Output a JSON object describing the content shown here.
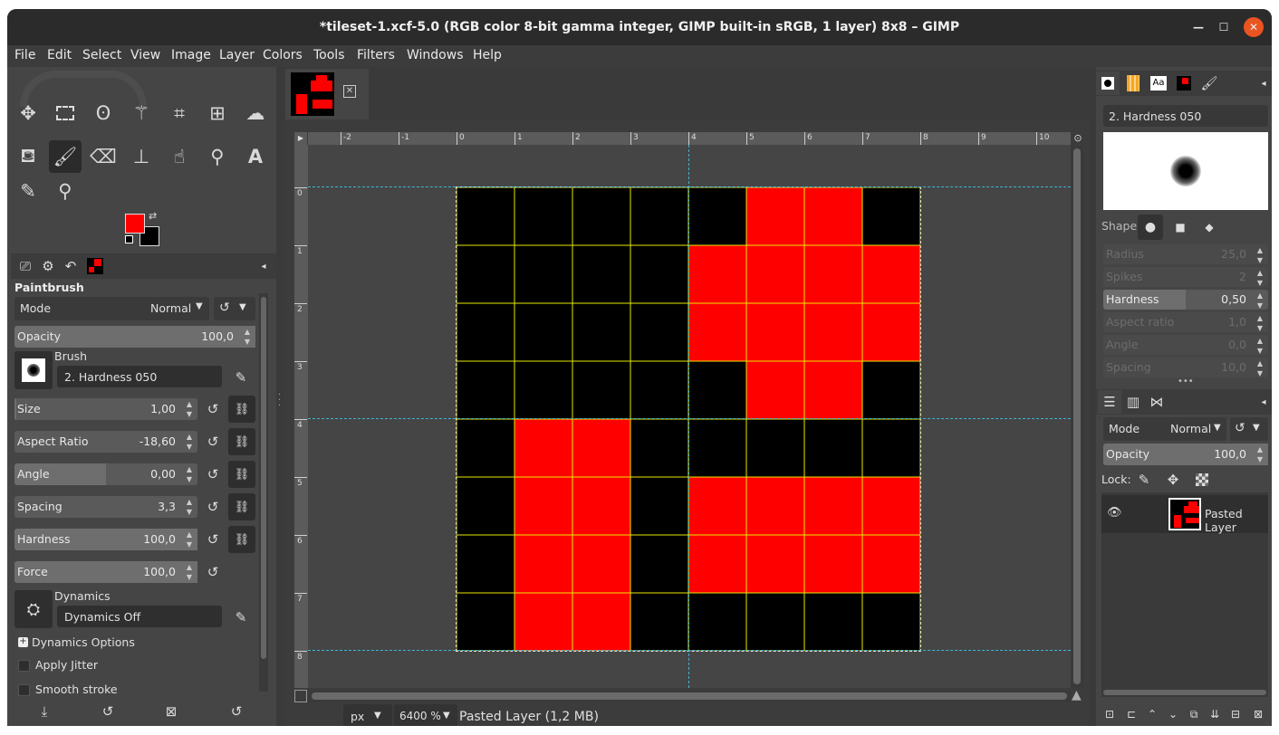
{
  "window": {
    "title": "*tileset-1.xcf-5.0 (RGB color 8-bit gamma integer, GIMP built-in sRGB, 1 layer) 8x8 – GIMP"
  },
  "menu": [
    "File",
    "Edit",
    "Select",
    "View",
    "Image",
    "Layer",
    "Colors",
    "Tools",
    "Filters",
    "Windows",
    "Help"
  ],
  "toolbox": {
    "tools": [
      "move-tool",
      "rect-select-tool",
      "free-select-tool",
      "fuzzy-select-tool",
      "crop-tool",
      "unified-transform-tool",
      "warp-transform-tool",
      "bucket-fill-tool",
      "paintbrush-tool",
      "eraser-tool",
      "clone-tool",
      "smudge-tool",
      "paths-tool",
      "text-tool",
      "color-picker-tool",
      "zoom-tool"
    ],
    "fg_color": "#ff0000",
    "bg_color": "#000000"
  },
  "tool_options": {
    "title": "Paintbrush",
    "mode_label": "Mode",
    "mode_value": "Normal",
    "opacity_label": "Opacity",
    "opacity_value": "100,0",
    "opacity_fraction": 1.0,
    "brush_label": "Brush",
    "brush_name": "2. Hardness 050",
    "sliders": [
      {
        "label": "Size",
        "value": "1,00",
        "fraction": 0.01,
        "chain": true
      },
      {
        "label": "Aspect Ratio",
        "value": "-18,60",
        "fraction": 0.0,
        "chain": true
      },
      {
        "label": "Angle",
        "value": "0,00",
        "fraction": 0.5,
        "chain": true
      },
      {
        "label": "Spacing",
        "value": "3,3",
        "fraction": 0.0,
        "chain": true
      },
      {
        "label": "Hardness",
        "value": "100,0",
        "fraction": 1.0,
        "chain": true
      },
      {
        "label": "Force",
        "value": "100,0",
        "fraction": 1.0,
        "chain": false
      }
    ],
    "dynamics_label": "Dynamics",
    "dynamics_value": "Dynamics Off",
    "dynamics_options": "Dynamics Options",
    "apply_jitter": "Apply Jitter",
    "smooth_stroke": "Smooth stroke"
  },
  "canvas": {
    "h_ruler": [
      "-2",
      "-1",
      "0",
      "1",
      "2",
      "3",
      "4",
      "5",
      "6",
      "7",
      "8",
      "9",
      "10"
    ],
    "v_ruler": [
      "0",
      "1",
      "2",
      "3",
      "4",
      "5",
      "6",
      "7",
      "8"
    ],
    "pixels": [
      "00000110",
      "00001111",
      "00001111",
      "00000110",
      "01100000",
      "01101111",
      "01101111",
      "01100000"
    ],
    "pixel_on": "#ff0000",
    "pixel_off": "#000000",
    "grid_color": "#e8e800"
  },
  "statusbar": {
    "unit": "px",
    "zoom": "6400 %",
    "info": "Pasted Layer (1,2 MB)"
  },
  "brushes_panel": {
    "brush_name": "2. Hardness 050",
    "shape_label": "Shape:",
    "params": [
      {
        "label": "Radius",
        "value": "25,0",
        "fraction": 0.0,
        "enabled": false
      },
      {
        "label": "Spikes",
        "value": "2",
        "fraction": 0.0,
        "enabled": false
      },
      {
        "label": "Hardness",
        "value": "0,50",
        "fraction": 0.5,
        "enabled": true
      },
      {
        "label": "Aspect ratio",
        "value": "1,0",
        "fraction": 0.0,
        "enabled": false
      },
      {
        "label": "Angle",
        "value": "0,0",
        "fraction": 0.0,
        "enabled": false
      },
      {
        "label": "Spacing",
        "value": "10,0",
        "fraction": 0.0,
        "enabled": false
      }
    ]
  },
  "layers_panel": {
    "mode_label": "Mode",
    "mode_value": "Normal",
    "opacity_label": "Opacity",
    "opacity_value": "100,0",
    "opacity_fraction": 1.0,
    "lock_label": "Lock:",
    "layers": [
      {
        "name": "Pasted Layer",
        "visible": true
      }
    ]
  }
}
